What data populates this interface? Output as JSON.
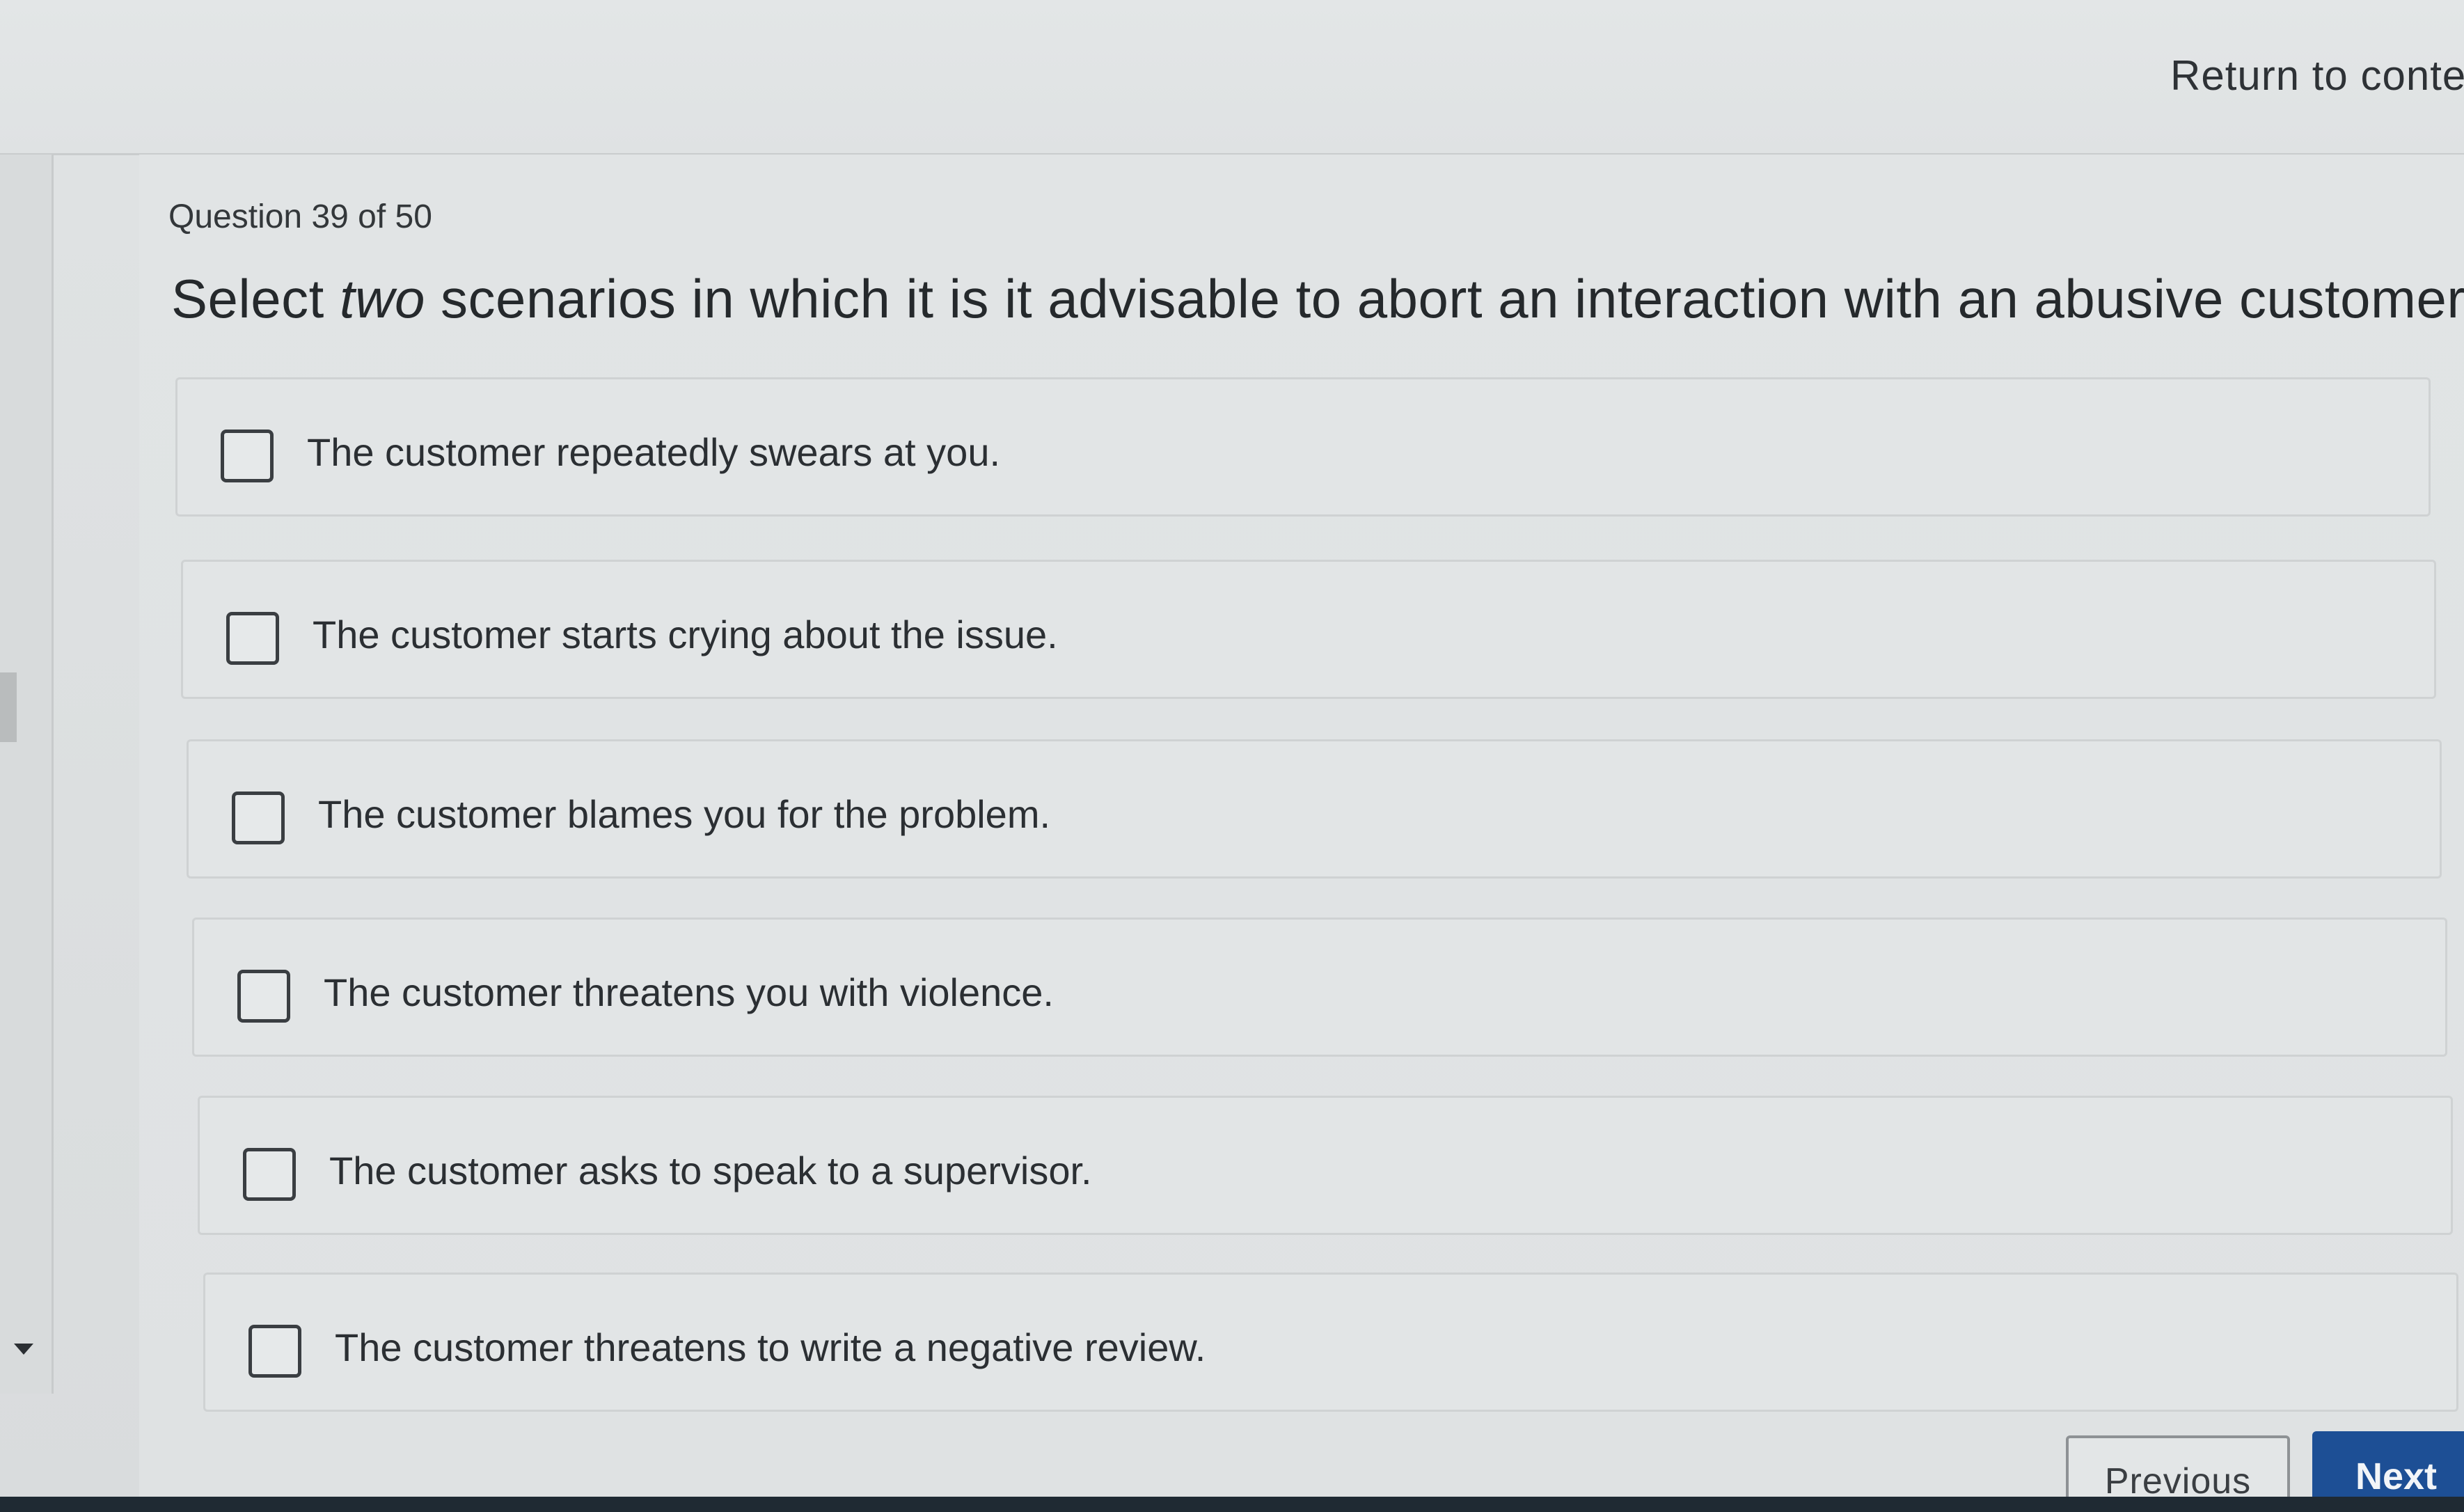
{
  "header": {
    "return_link": "Return to conte"
  },
  "question": {
    "counter": "Question 39 of 50",
    "prompt_before": "Select ",
    "prompt_emphasis": "two",
    "prompt_after": " scenarios in which it is it advisable to abort an interaction with an abusive customer."
  },
  "options": [
    {
      "label": "The customer repeatedly swears at you.",
      "checked": false
    },
    {
      "label": "The customer starts crying about the issue.",
      "checked": false
    },
    {
      "label": "The customer blames you for the problem.",
      "checked": false
    },
    {
      "label": "The customer threatens you with violence.",
      "checked": false
    },
    {
      "label": "The customer asks to speak to a supervisor.",
      "checked": false
    },
    {
      "label": "The customer threatens to write a negative review.",
      "checked": false
    }
  ],
  "nav": {
    "previous_label": "Previous",
    "next_label": "Next",
    "next_color": "#1d4f95"
  }
}
